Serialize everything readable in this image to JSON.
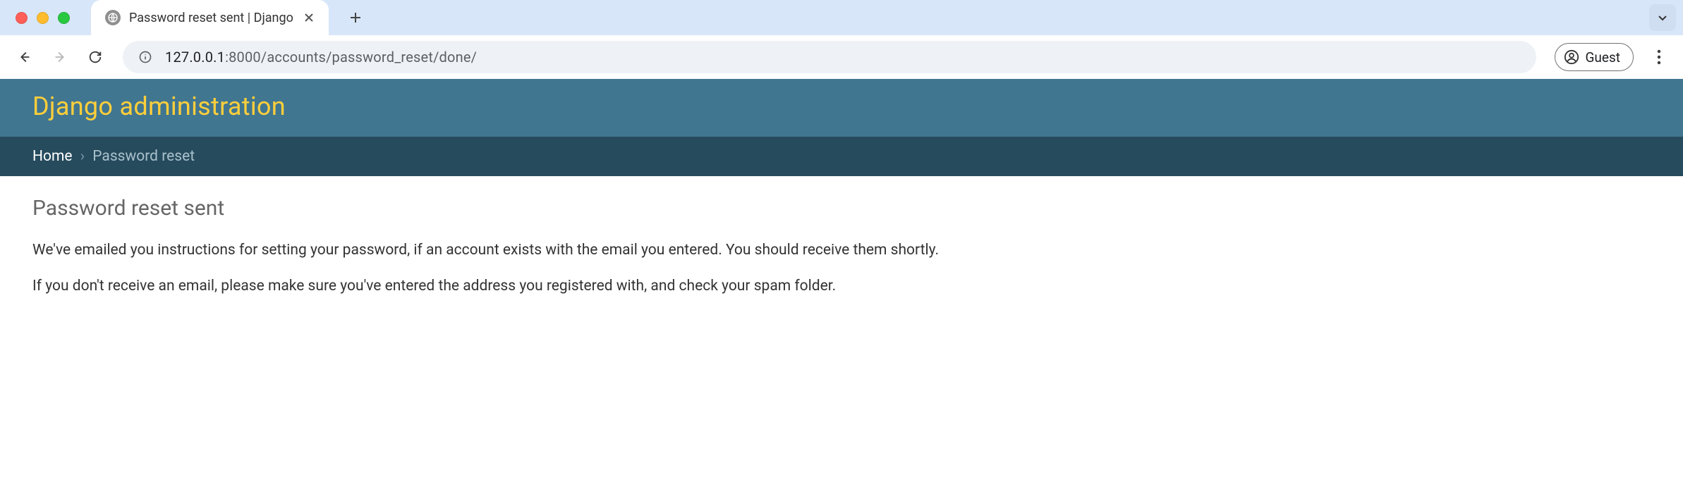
{
  "browser": {
    "tab_title": "Password reset sent | Django",
    "url_host": "127.0.0.1",
    "url_port_path": ":8000/accounts/password_reset/done/",
    "profile_label": "Guest"
  },
  "admin": {
    "site_title": "Django administration",
    "breadcrumb_home": "Home",
    "breadcrumb_sep": "›",
    "breadcrumb_current": "Password reset",
    "heading": "Password reset sent",
    "paragraph1": "We've emailed you instructions for setting your password, if an account exists with the email you entered. You should receive them shortly.",
    "paragraph2": "If you don't receive an email, please make sure you've entered the address you registered with, and check your spam folder."
  }
}
